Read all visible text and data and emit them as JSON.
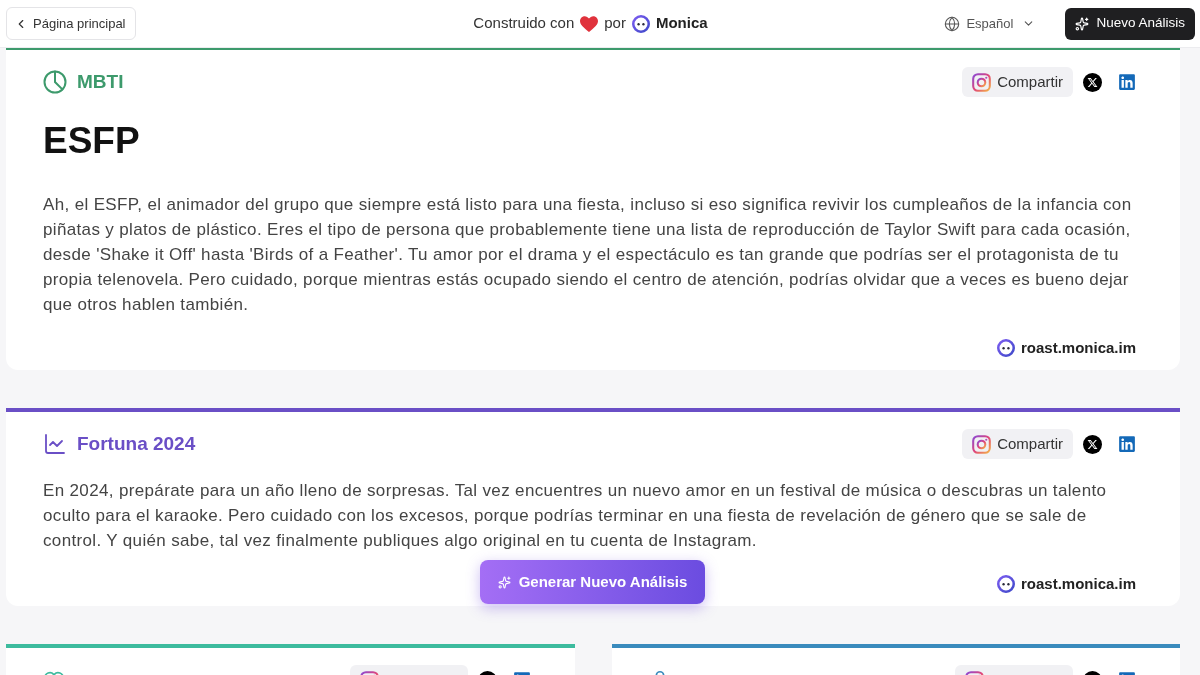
{
  "header": {
    "back_button": {
      "label": "Página principal"
    },
    "credit": {
      "prefix": "Construido con",
      "middle": "por",
      "brand": "Monica"
    },
    "language": {
      "label": "Español"
    },
    "new_button": {
      "label": "Nuevo Análisis"
    }
  },
  "cards": [
    {
      "kind": "mbti",
      "color": "#3d9a6c",
      "title": "MBTI",
      "result": "ESFP",
      "text": "Ah, el ESFP, el animador del grupo que siempre está listo para una fiesta, incluso si eso significa revivir los cumpleaños de la infancia con piñatas y platos de plástico. Eres el tipo de persona que probablemente tiene una lista de reproducción de Taylor Swift para cada ocasión, desde 'Shake it Off' hasta 'Birds of a Feather'. Tu amor por el drama y el espectáculo es tan grande que podrías ser el protagonista de tu propia telenovela. Pero cuidado, porque mientras estás ocupado siendo el centro de atención, podrías olvidar que a veces es bueno dejar que otros hablen también.",
      "share_label": "Compartir",
      "site": "roast.monica.im"
    },
    {
      "kind": "fortune",
      "color": "#6a4fc6",
      "title": "Fortuna 2024",
      "text": "En 2024, prepárate para un año lleno de sorpresas. Tal vez encuentres un nuevo amor en un festival de música o descubras un talento oculto para el karaoke. Pero cuidado con los excesos, porque podrías terminar en una fiesta de revelación de género que se sale de control. Y quién sabe, tal vez finalmente publiques algo original en tu cuenta de Instagram.",
      "share_label": "Compartir",
      "site": "roast.monica.im"
    }
  ],
  "more_cards": [
    {
      "color": "#3dbb9e"
    },
    {
      "color": "#3a8bbd"
    }
  ],
  "floating_button": {
    "label": "Generar Nuevo Análisis"
  }
}
